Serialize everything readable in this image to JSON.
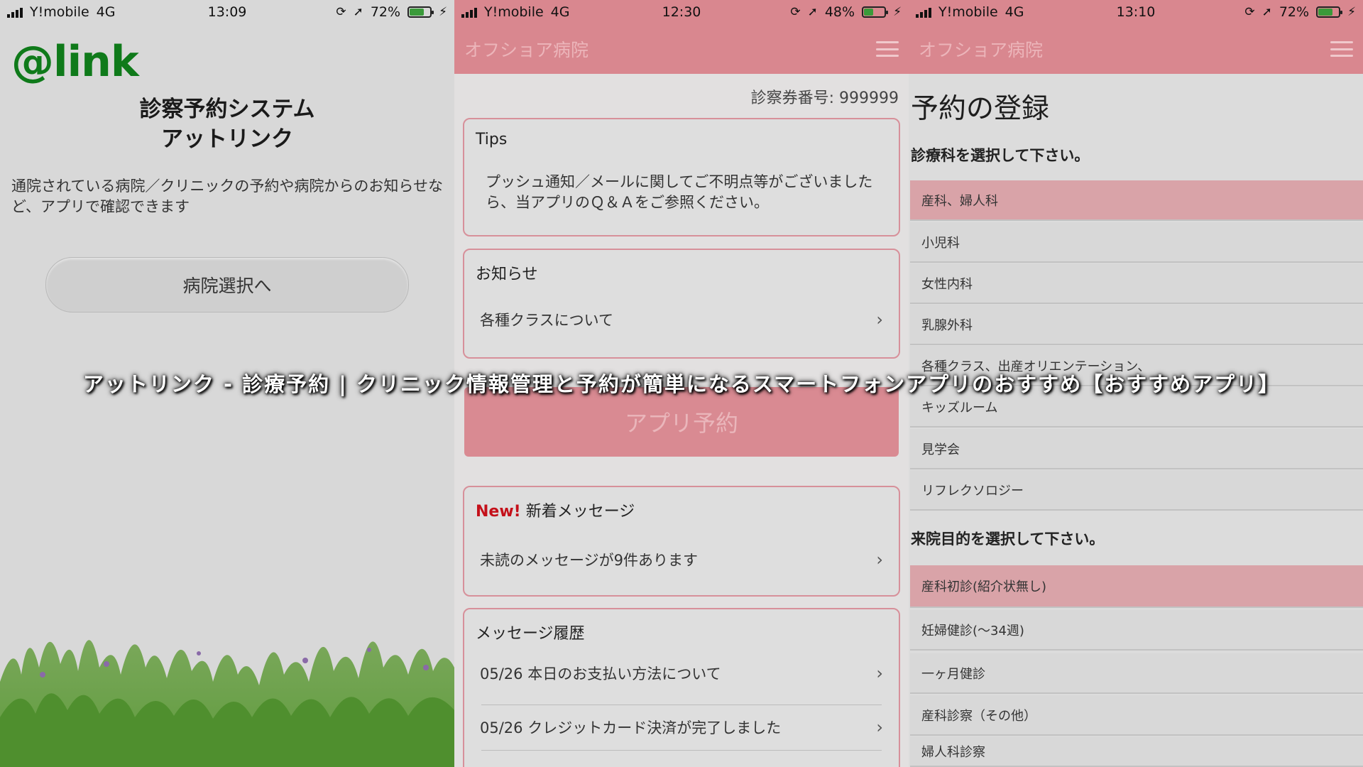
{
  "screens": [
    {
      "status": {
        "carrier": "Y!mobile",
        "network": "4G",
        "time": "13:09",
        "battery": "72%",
        "battery_level": 0.72
      },
      "logo": "@link",
      "title_line1": "診察予約システム",
      "title_line2": "アットリンク",
      "description": "通院されている病院／クリニックの予約や病院からのお知らせなど、アプリで確認できます",
      "button_label": "病院選択へ"
    },
    {
      "status": {
        "carrier": "Y!mobile",
        "network": "4G",
        "time": "12:30",
        "battery": "48%",
        "battery_level": 0.48
      },
      "header_title": "オフショア病院",
      "patient_number": "診察券番号: 999999",
      "tips": {
        "heading": "Tips",
        "body": "プッシュ通知／メールに関してご不明点等がございましたら、当アプリのＱ＆Ａをご参照ください。"
      },
      "notice": {
        "heading": "お知らせ",
        "item": "各種クラスについて"
      },
      "app_booking_button": "アプリ予約",
      "new_messages": {
        "new_label": "New!",
        "heading": "新着メッセージ",
        "item": "未読のメッセージが9件あります"
      },
      "history": {
        "heading": "メッセージ履歴",
        "items": [
          "05/26 本日のお支払い方法について",
          "05/26 クレジットカード決済が完了しました"
        ]
      }
    },
    {
      "status": {
        "carrier": "Y!mobile",
        "network": "4G",
        "time": "13:10",
        "battery": "72%",
        "battery_level": 0.72
      },
      "header_title": "オフショア病院",
      "page_title": "予約の登録",
      "department_prompt": "診療科を選択して下さい。",
      "departments": [
        "産科、婦人科",
        "小児科",
        "女性内科",
        "乳腺外科",
        "各種クラス、出産オリエンテーション、",
        "キッズルーム",
        "見学会",
        "リフレクソロジー"
      ],
      "purpose_prompt": "来院目的を選択して下さい。",
      "purposes": [
        "産科初診(紹介状無し)",
        "妊婦健診(〜34週)",
        "一ヶ月健診",
        "産科診察（その他）",
        "婦人科診察"
      ]
    }
  ],
  "overlay_caption": "アットリンク - 診療予約 | クリニック情報管理と予約が簡単になるスマートフォンアプリのおすすめ【おすすめアプリ】",
  "colors": {
    "header_pink": "#d9878f",
    "logo_green": "#0f7a1a",
    "new_red": "#c4101a",
    "card_border": "#d7909a"
  }
}
